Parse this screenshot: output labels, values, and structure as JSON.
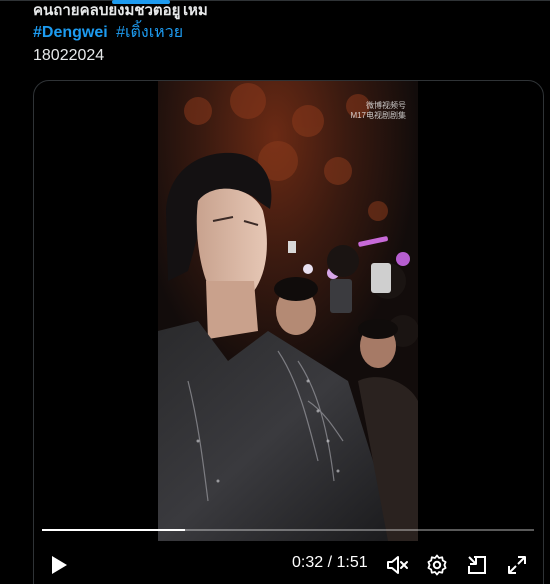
{
  "tweet": {
    "line1": "คนถ่ายคลิปยังมีชีวิตอยู่ไหม",
    "hashtag1": "#Dengwei",
    "hashtag2": "#เติ้งเหวย",
    "date_text": "18022024"
  },
  "video": {
    "watermark_line1": "微博视频号",
    "watermark_line2": "M17电视剧剧集",
    "progress": 0.29,
    "current_time": "0:32",
    "separator": "/",
    "duration": "1:51"
  },
  "icons": {
    "play": "play-icon",
    "mute": "volume-muted-icon",
    "settings": "gear-icon",
    "pip": "picture-in-picture-icon",
    "fullscreen": "fullscreen-icon"
  },
  "colors": {
    "accent": "#1d9bf0",
    "background": "#000000",
    "text": "#e7e9ea"
  }
}
